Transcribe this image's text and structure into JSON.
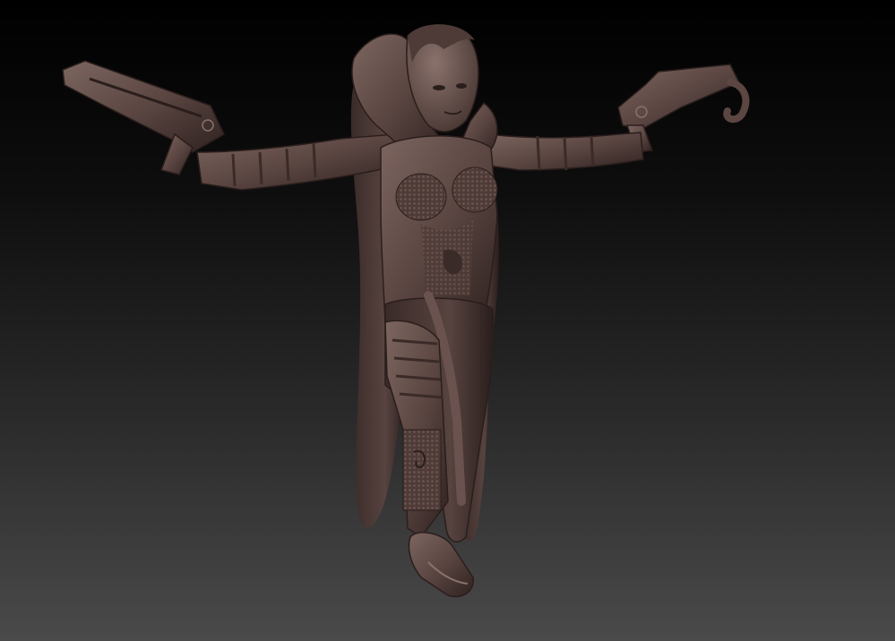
{
  "scene": {
    "subject": "sculpted-figure-with-two-crossbows",
    "background_top_color": "#000000",
    "background_bottom_color": "#4a4a4a",
    "material_base_color": "#5b4642",
    "material_shadow_color": "#2a1e1c",
    "material_highlight_color": "#8a726c"
  }
}
